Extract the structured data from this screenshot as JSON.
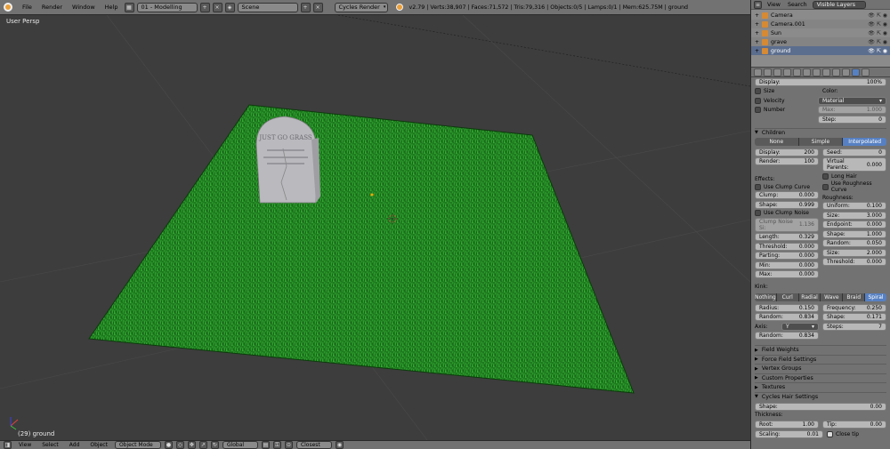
{
  "header": {
    "menus": [
      "File",
      "Render",
      "Window",
      "Help"
    ],
    "layout": "01 - Modelling",
    "scene": "Scene",
    "engine": "Cycles Render",
    "stats": "v2.79 | Verts:38,907 | Faces:71,572 | Tris:79,316 | Objects:0/5 | Lamps:0/1 | Mem:625.75M | ground"
  },
  "viewport": {
    "view_name": "User Persp",
    "object_label": "(29) ground",
    "tombstone_text": "JUST GO GRASS"
  },
  "bottombar": {
    "menus": [
      "View",
      "Select",
      "Add",
      "Object"
    ],
    "mode": "Object Mode",
    "orientation": "Global",
    "snap": "Closest"
  },
  "outliner": {
    "tabs": [
      "View",
      "Search"
    ],
    "filter": "Visible Layers",
    "items": [
      {
        "name": "Camera"
      },
      {
        "name": "Camera.001"
      },
      {
        "name": "Sun"
      },
      {
        "name": "grave"
      },
      {
        "name": "ground"
      }
    ]
  },
  "props": {
    "display": {
      "label": "Display:",
      "value": "100%"
    },
    "checks_left": [
      "Size",
      "Velocity",
      "Number"
    ],
    "color_label": "Color:",
    "color_value": "Material",
    "max": {
      "label": "Max:",
      "value": "1.000"
    },
    "step": {
      "label": "Step:",
      "value": "0"
    },
    "children": {
      "title": "Children",
      "modes": [
        "None",
        "Simple",
        "Interpolated"
      ],
      "display": {
        "label": "Display:",
        "value": "200"
      },
      "render": {
        "label": "Render:",
        "value": "100"
      },
      "seed": {
        "label": "Seed:",
        "value": "0"
      },
      "virtual_parents": {
        "label": "Virtual Parents:",
        "value": "0.000"
      },
      "long_hair": "Long Hair",
      "effects": "Effects:",
      "use_roughness_curve": "Use Roughness Curve",
      "use_clump_curve": "Use Clump Curve",
      "roughness": "Roughness:",
      "clump": {
        "label": "Clump:",
        "value": "0.000"
      },
      "shape": {
        "label": "Shape:",
        "value": "0.999"
      },
      "use_clump_noise": "Use Clump Noise",
      "clump_noise": {
        "label": "Clump Noise Si:",
        "value": "1.136"
      },
      "uniform": {
        "label": "Uniform:",
        "value": "0.100"
      },
      "r_size": {
        "label": "Size:",
        "value": "3.000"
      },
      "endpoint": {
        "label": "Endpoint:",
        "value": "0.000"
      },
      "r_shape": {
        "label": "Shape:",
        "value": "1.000"
      },
      "random": {
        "label": "Random:",
        "value": "0.050"
      },
      "r_size2": {
        "label": "Size:",
        "value": "2.000"
      },
      "threshold2": {
        "label": "Threshold:",
        "value": "0.000"
      },
      "length": {
        "label": "Length:",
        "value": "0.329"
      },
      "threshold": {
        "label": "Threshold:",
        "value": "0.000"
      },
      "parting": {
        "label": "Parting:",
        "value": "0.000"
      },
      "min": {
        "label": "Min:",
        "value": "0.000"
      },
      "max": {
        "label": "Max:",
        "value": "0.000"
      },
      "kink": "Kink:",
      "kink_modes": [
        "Nothing",
        "Curl",
        "Radial",
        "Wave",
        "Braid",
        "Spiral"
      ],
      "radius": {
        "label": "Radius:",
        "value": "0.150"
      },
      "k_random": {
        "label": "Random:",
        "value": "0.834"
      },
      "frequency": {
        "label": "Frequency:",
        "value": "0.250"
      },
      "k_shape": {
        "label": "Shape:",
        "value": "0.171"
      },
      "steps": {
        "label": "Steps:",
        "value": "7"
      },
      "axis": {
        "label": "Axis:",
        "value": "Y"
      },
      "k_random2": {
        "label": "Random:",
        "value": "0.834"
      }
    },
    "sections": [
      "Field Weights",
      "Force Field Settings",
      "Vertex Groups",
      "Custom Properties",
      "Textures"
    ],
    "cycles": {
      "title": "Cycles Hair Settings",
      "shape": {
        "label": "Shape:",
        "value": "0.00"
      },
      "thickness": "Thickness:",
      "root": {
        "label": "Root:",
        "value": "1.00"
      },
      "tip": {
        "label": "Tip:",
        "value": "0.00"
      },
      "scaling": {
        "label": "Scaling:",
        "value": "0.01"
      },
      "close_tip": "Close tip"
    }
  }
}
